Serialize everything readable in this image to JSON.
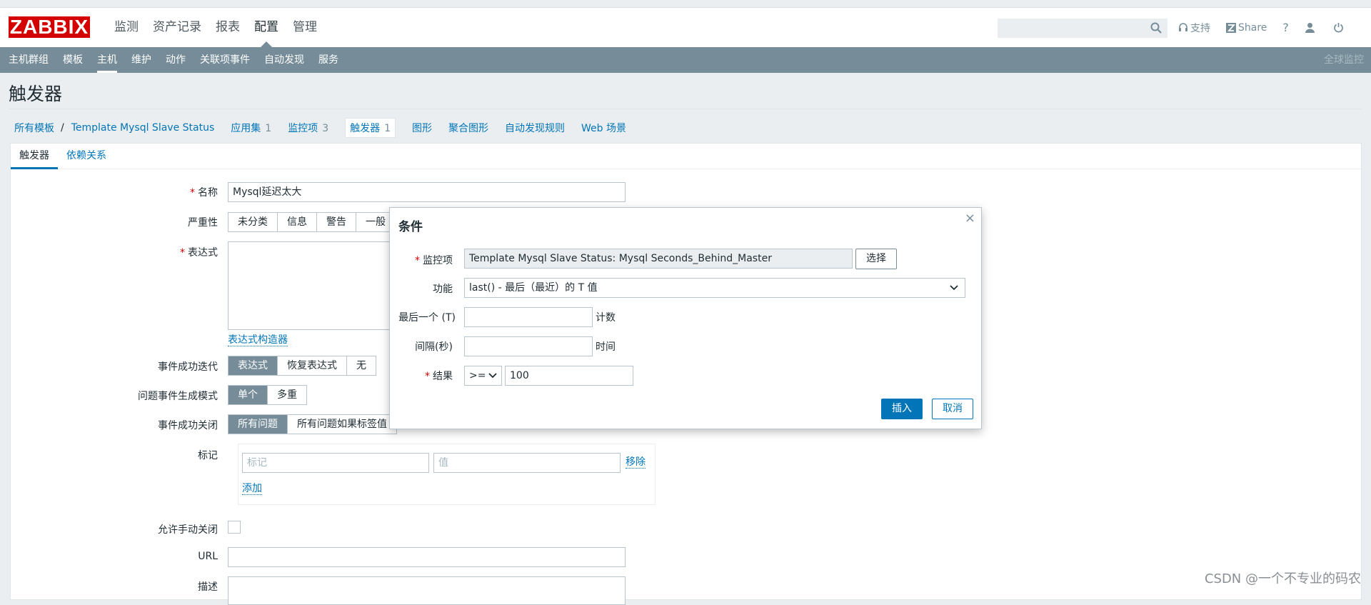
{
  "logo": "ZABBIX",
  "main_menu": [
    "监测",
    "资产记录",
    "报表",
    "配置",
    "管理"
  ],
  "top_links": {
    "support": "支持",
    "share": "Share",
    "help": "?"
  },
  "sub_menu": [
    "主机群组",
    "模板",
    "主机",
    "维护",
    "动作",
    "关联项事件",
    "自动发现",
    "服务"
  ],
  "global_view": "全球监控",
  "page_title": "触发器",
  "breadcrumb": {
    "all_templates": "所有模板",
    "separator": "/",
    "template": "Template Mysql Slave Status",
    "apps": "应用集",
    "apps_count": "1",
    "items": "监控项",
    "items_count": "3",
    "triggers": "触发器",
    "triggers_count": "1",
    "graphs": "图形",
    "screens": "聚合图形",
    "discovery": "自动发现规则",
    "web": "Web 场景"
  },
  "tabs": [
    "触发器",
    "依赖关系"
  ],
  "form": {
    "required_mark": "*",
    "name_label": "名称",
    "name_value": "Mysql延迟太大",
    "severity_label": "严重性",
    "severity_options": [
      "未分类",
      "信息",
      "警告",
      "一般"
    ],
    "expression_label": "表达式",
    "expr_builder": "表达式构造器",
    "ok_event_label": "事件成功迭代",
    "ok_event_options": [
      "表达式",
      "恢复表达式",
      "无"
    ],
    "problem_mode_label": "问题事件生成模式",
    "problem_mode_options": [
      "单个",
      "多重"
    ],
    "ok_close_label": "事件成功关闭",
    "ok_close_options": [
      "所有问题",
      "所有问题如果标签值"
    ],
    "tags_label": "标记",
    "tag_placeholder": "标记",
    "value_placeholder": "值",
    "remove": "移除",
    "add": "添加",
    "manual_close_label": "允许手动关闭",
    "url_label": "URL",
    "desc_label": "描述"
  },
  "modal": {
    "title": "条件",
    "close": "×",
    "item_label": "监控项",
    "item_value": "Template Mysql Slave Status: Mysql Seconds_Behind_Master",
    "select_btn": "选择",
    "function_label": "功能",
    "function_value": "last() - 最后（最近）的 T 值",
    "last_label": "最后一个 (T)",
    "last_unit": "计数",
    "interval_label": "间隔(秒)",
    "interval_unit": "时间",
    "result_label": "结果",
    "result_op": ">=",
    "result_value": "100",
    "insert_btn": "插入",
    "cancel_btn": "取消"
  },
  "watermark": "CSDN @一个不专业的码农",
  "colors": {
    "logo_bg": "#d40000",
    "subnav_bg": "#768d99",
    "link": "#0275b8",
    "page_bg": "#ebeef0"
  }
}
